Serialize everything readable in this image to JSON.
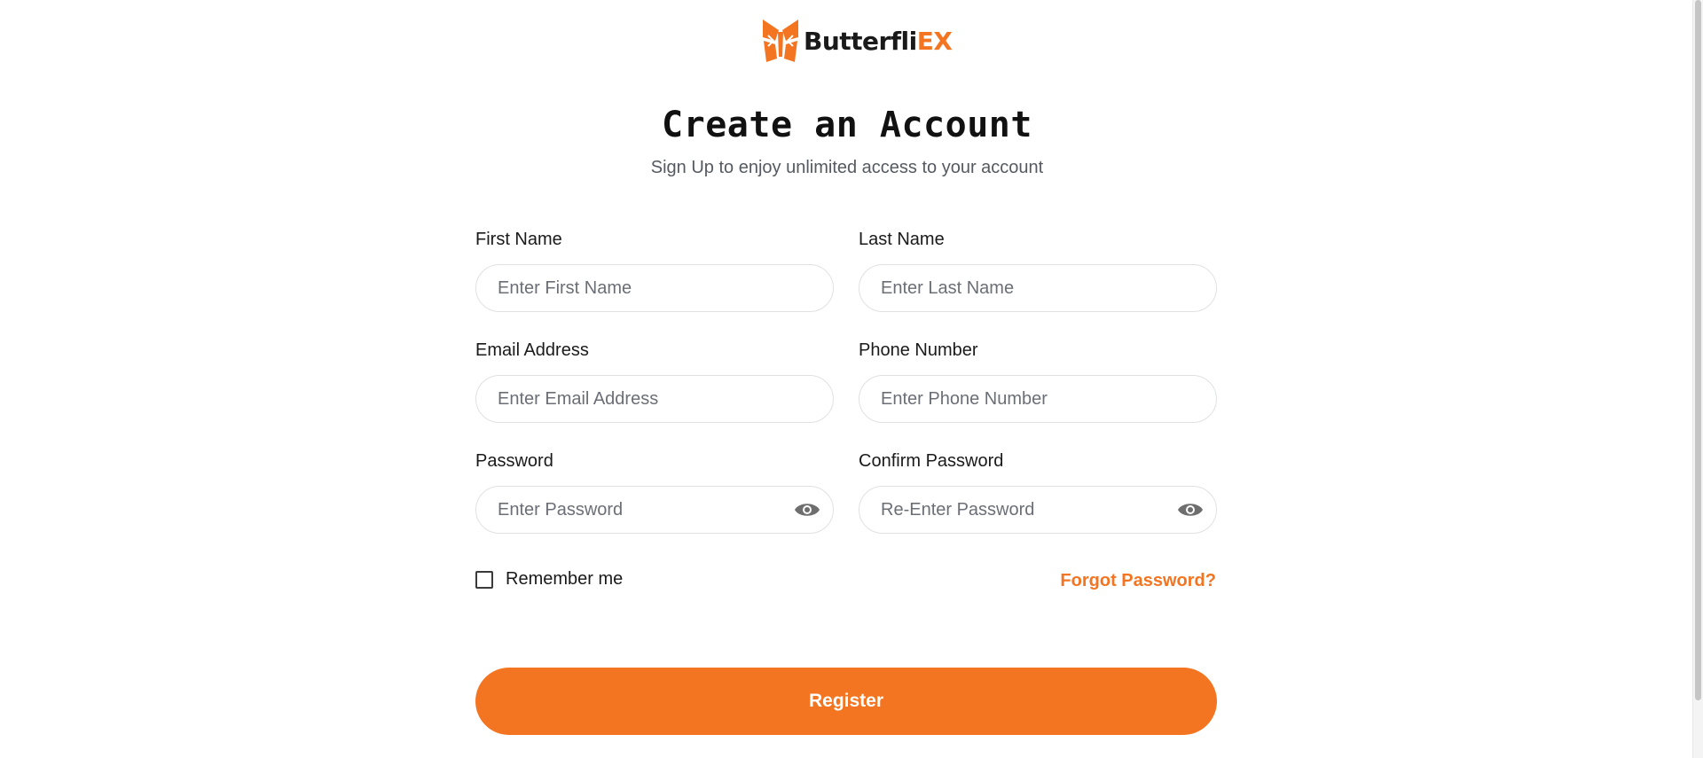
{
  "brand": {
    "name_main": "Butterfli",
    "name_accent": "EX",
    "accent_color": "#f47521",
    "logo_icon": "butterfly-logo-icon"
  },
  "header": {
    "title": "Create an Account",
    "subtitle": "Sign Up to enjoy unlimited access to your account"
  },
  "form": {
    "first_name": {
      "label": "First Name",
      "placeholder": "Enter First Name",
      "value": ""
    },
    "last_name": {
      "label": "Last Name",
      "placeholder": "Enter Last Name",
      "value": ""
    },
    "email": {
      "label": "Email Address",
      "placeholder": "Enter Email Address",
      "value": ""
    },
    "phone": {
      "label": "Phone Number",
      "placeholder": "Enter Phone Number",
      "value": ""
    },
    "password": {
      "label": "Password",
      "placeholder": "Enter Password",
      "value": "",
      "icon": "eye-icon"
    },
    "confirm_password": {
      "label": "Confirm Password",
      "placeholder": "Re-Enter Password",
      "value": "",
      "icon": "eye-icon"
    },
    "remember_label": "Remember me",
    "remember_checked": false,
    "forgot_label": "Forgot Password?",
    "register_label": "Register"
  }
}
